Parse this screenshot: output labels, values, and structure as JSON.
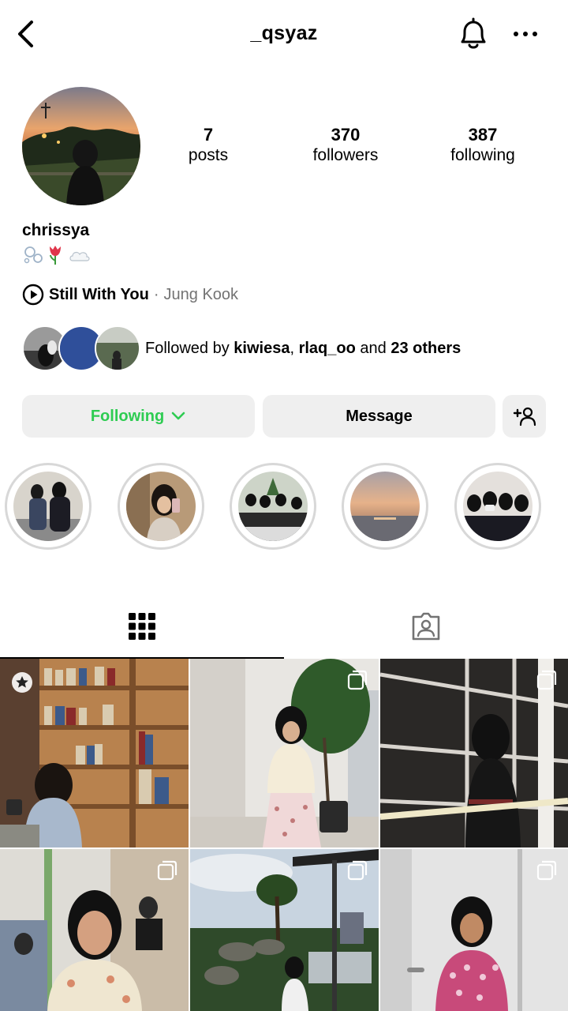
{
  "header": {
    "username": "_qsyaz",
    "back_icon": "chevron-left-icon",
    "notification_icon": "bell-icon",
    "more_icon": "more-horizontal-icon"
  },
  "profile": {
    "stats": {
      "posts_count": "7",
      "posts_label": "posts",
      "followers_count": "370",
      "followers_label": "followers",
      "following_count": "387",
      "following_label": "following"
    },
    "display_name": "chrissya",
    "bio_emojis": [
      "bubbles",
      "tulip",
      "cloud"
    ],
    "music": {
      "title": "Still With You",
      "separator": "·",
      "artist": "Jung Kook"
    },
    "followed_by": {
      "prefix": "Followed by",
      "user1": "kiwiesa",
      "comma": ",",
      "user2": "rlaq_oo",
      "and": "and",
      "others": "23 others"
    }
  },
  "actions": {
    "following_label": "Following",
    "message_label": "Message",
    "suggest_icon": "add-person-icon"
  },
  "tabs": {
    "grid_icon": "grid-icon",
    "tagged_icon": "tagged-person-icon"
  },
  "colors": {
    "accent_green": "#2ecc52",
    "button_bg": "#efefef",
    "muted_text": "#737373"
  }
}
